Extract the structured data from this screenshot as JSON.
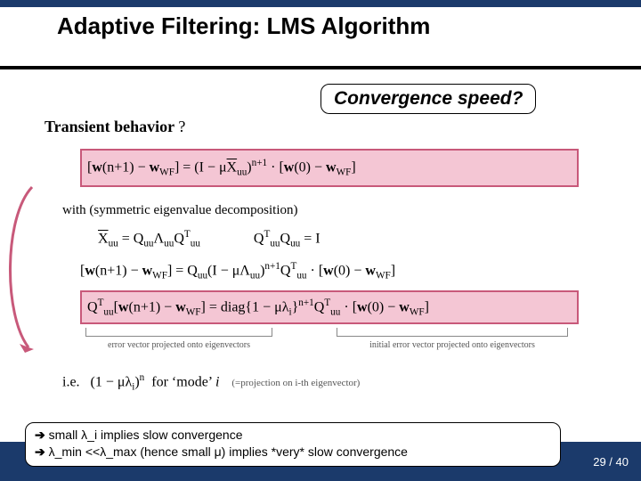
{
  "title": "Adaptive Filtering: LMS Algorithm",
  "callout": "Convergence speed?",
  "heading": {
    "label": "Transient behavior",
    "mark": "?"
  },
  "eq1": "[w(n+1) − w_WF] = (I − μX̄_uu)^{n+1} · [w(0) − w_WF]",
  "withline": "with (symmetric eigenvalue decomposition)",
  "eqrow": {
    "a": "X̄_uu = Q_uu Λ_uu Q_uu^T",
    "b": "Q_uu^T Q_uu = I"
  },
  "eq2": "[w(n+1) − w_WF] = Q_uu (I − μΛ_uu)^{n+1} Q_uu^T · [w(0) − w_WF]",
  "eq3": "Q_uu^T [w(n+1) − w_WF] = diag{1 − μλ_i}^{n+1} Q_uu^T · [w(0) − w_WF]",
  "braces": {
    "left": "error vector projected onto eigenvectors",
    "right": "initial error vector projected onto eigenvectors"
  },
  "ie": {
    "prefix": "i.e.",
    "expr": "(1 − μλ_i)^n  for ‘mode’ i",
    "note": "(=projection on i-th eigenvector)"
  },
  "footer": {
    "line1": "small λ_i implies slow convergence",
    "line2": "λ_min <<λ_max (hence small μ) implies *very* slow convergence"
  },
  "page": {
    "current": "29",
    "total": "40"
  }
}
